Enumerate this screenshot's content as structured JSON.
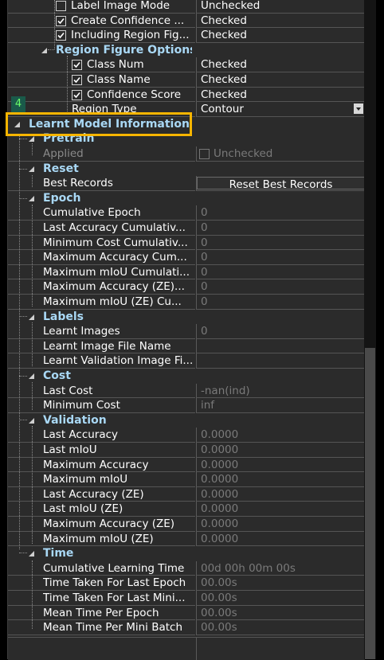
{
  "marker": "4",
  "rows": [
    {
      "type": "prop",
      "indent": 2,
      "checkbox": false,
      "label": "Label Image Mode",
      "value": "Unchecked"
    },
    {
      "type": "prop",
      "indent": 2,
      "checkbox": true,
      "label": "Create Confidence ...",
      "value": "Checked"
    },
    {
      "type": "prop",
      "indent": 2,
      "checkbox": true,
      "label": "Including Region Fig...",
      "value": "Checked"
    },
    {
      "type": "cat",
      "indent": 2,
      "label": "Region Figure Options"
    },
    {
      "type": "prop",
      "indent": 3,
      "checkbox": true,
      "label": "Class Num",
      "value": "Checked"
    },
    {
      "type": "prop",
      "indent": 3,
      "checkbox": true,
      "label": "Class Name",
      "value": "Checked"
    },
    {
      "type": "prop",
      "indent": 3,
      "checkbox": true,
      "label": "Confidence Score",
      "value": "Checked"
    },
    {
      "type": "prop",
      "indent": 3,
      "label": "Region Type",
      "value": "Contour",
      "dropdown": true
    },
    {
      "type": "cat",
      "indent": 0,
      "label": "Learnt Model Information"
    },
    {
      "type": "cat",
      "indent": 1,
      "label": "Pretrain"
    },
    {
      "type": "prop",
      "indent": 1,
      "label": "Applied",
      "value": "Unchecked",
      "value_checkbox": true,
      "disabled": true
    },
    {
      "type": "cat",
      "indent": 1,
      "label": "Reset"
    },
    {
      "type": "prop",
      "indent": 1,
      "label": "Best Records",
      "value": "Reset Best Records",
      "button": true
    },
    {
      "type": "cat",
      "indent": 1,
      "label": "Epoch"
    },
    {
      "type": "prop",
      "indent": 1,
      "label": "Cumulative Epoch",
      "value": "0",
      "gray": true
    },
    {
      "type": "prop",
      "indent": 1,
      "label": "Last Accuracy Cumulativ...",
      "value": "0",
      "gray": true
    },
    {
      "type": "prop",
      "indent": 1,
      "label": "Minimum Cost Cumulativ...",
      "value": "0",
      "gray": true
    },
    {
      "type": "prop",
      "indent": 1,
      "label": "Maximum Accuracy Cum...",
      "value": "0",
      "gray": true
    },
    {
      "type": "prop",
      "indent": 1,
      "label": "Maximum mIoU Cumulati...",
      "value": "0",
      "gray": true
    },
    {
      "type": "prop",
      "indent": 1,
      "label": "Maximum Accuracy (ZE)...",
      "value": "0",
      "gray": true
    },
    {
      "type": "prop",
      "indent": 1,
      "label": "Maximum mIoU (ZE) Cu...",
      "value": "0",
      "gray": true
    },
    {
      "type": "cat",
      "indent": 1,
      "label": "Labels"
    },
    {
      "type": "prop",
      "indent": 1,
      "label": "Learnt Images",
      "value": "0",
      "gray": true
    },
    {
      "type": "prop",
      "indent": 1,
      "label": "Learnt Image File Name",
      "value": ""
    },
    {
      "type": "prop",
      "indent": 1,
      "label": "Learnt Validation Image Fi...",
      "value": ""
    },
    {
      "type": "cat",
      "indent": 1,
      "label": "Cost"
    },
    {
      "type": "prop",
      "indent": 1,
      "label": "Last Cost",
      "value": "-nan(ind)",
      "gray": true
    },
    {
      "type": "prop",
      "indent": 1,
      "label": "Minimum Cost",
      "value": "inf",
      "gray": true
    },
    {
      "type": "cat",
      "indent": 1,
      "label": "Validation"
    },
    {
      "type": "prop",
      "indent": 1,
      "label": "Last Accuracy",
      "value": "0.0000",
      "gray": true
    },
    {
      "type": "prop",
      "indent": 1,
      "label": "Last mIoU",
      "value": "0.0000",
      "gray": true
    },
    {
      "type": "prop",
      "indent": 1,
      "label": "Maximum Accuracy",
      "value": "0.0000",
      "gray": true
    },
    {
      "type": "prop",
      "indent": 1,
      "label": "Maximum mIoU",
      "value": "0.0000",
      "gray": true
    },
    {
      "type": "prop",
      "indent": 1,
      "label": "Last Accuracy (ZE)",
      "value": "0.0000",
      "gray": true
    },
    {
      "type": "prop",
      "indent": 1,
      "label": "Last mIoU (ZE)",
      "value": "0.0000",
      "gray": true
    },
    {
      "type": "prop",
      "indent": 1,
      "label": "Maximum Accuracy (ZE)",
      "value": "0.0000",
      "gray": true
    },
    {
      "type": "prop",
      "indent": 1,
      "label": "Maximum mIoU (ZE)",
      "value": "0.0000",
      "gray": true
    },
    {
      "type": "cat",
      "indent": 1,
      "label": "Time"
    },
    {
      "type": "prop",
      "indent": 1,
      "label": "Cumulative Learning Time",
      "value": "00d 00h 00m 00s",
      "gray": true
    },
    {
      "type": "prop",
      "indent": 1,
      "label": "Time Taken For Last Epoch",
      "value": "00.00s",
      "gray": true
    },
    {
      "type": "prop",
      "indent": 1,
      "label": "Time Taken For Last Mini...",
      "value": "00.00s",
      "gray": true
    },
    {
      "type": "prop",
      "indent": 1,
      "label": "Mean Time Per Epoch",
      "value": "00.00s",
      "gray": true
    },
    {
      "type": "prop",
      "indent": 1,
      "label": "Mean Time Per Mini Batch",
      "value": "00.00s",
      "gray": true
    }
  ],
  "colors": {
    "category_text": "#a9d8f5",
    "highlight": "#f7b500",
    "marker_bg": "#1a5a4a",
    "marker_fg": "#6aff6a"
  }
}
